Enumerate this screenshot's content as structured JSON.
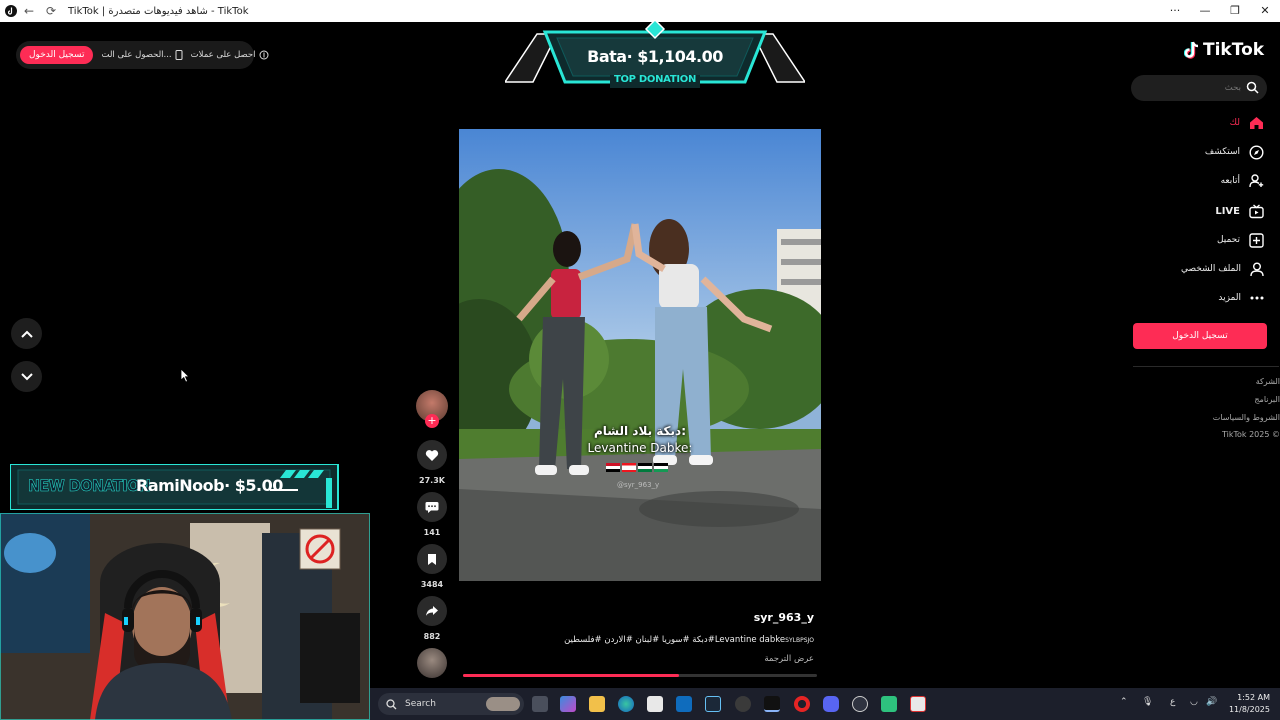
{
  "browser": {
    "tab_title": "TikTok | شاهد فيديوهات متصدرة - TikTok",
    "controls": {
      "minimize": "—",
      "restore": "❐",
      "close": "✕",
      "more": "···"
    }
  },
  "topbar": {
    "signin_label": "تسجيل الدخول",
    "get_app_label": "الحصول على الت...",
    "get_coins_label": "احصل على عملات"
  },
  "overlay_top_donation": {
    "amount_text": "Bata· $1,104.00",
    "caption": "TOP DONATION"
  },
  "overlay_new_donation": {
    "label": "NEW DONATION",
    "donor_text": "RamiNoob· $5.00"
  },
  "video": {
    "caption_line1": "دبكة بلاد الشام:",
    "caption_line2": "Levantine Dabke:",
    "watermark": "@syr_963_y",
    "progress": 0.61
  },
  "actions": {
    "likes": "27.3K",
    "comments": "141",
    "saves": "3484",
    "shares": "882"
  },
  "video_info": {
    "username": "syr_963_y",
    "description": "دبكة #سوريا #لبنان #الاردن #فلسطين#Levantine dabke",
    "description_suffix": "SYLBPSJO",
    "translate_label": "عرض الترجمة"
  },
  "sidebar": {
    "logo_text": "TikTok",
    "search_placeholder": "بحث",
    "items": [
      {
        "label": "لك",
        "icon": "home-icon"
      },
      {
        "label": "استكشف",
        "icon": "compass-icon"
      },
      {
        "label": "أتابعه",
        "icon": "user-plus-icon"
      },
      {
        "label": "LIVE",
        "icon": "live-icon"
      },
      {
        "label": "تحميل",
        "icon": "upload-icon"
      },
      {
        "label": "الملف الشخصي",
        "icon": "profile-icon"
      },
      {
        "label": "المزيد",
        "icon": "more-icon"
      }
    ],
    "signin_button": "تسجيل الدخول",
    "footer": [
      "الشركة",
      "البرنامج",
      "الشروط والسياسات",
      "TikTok 2025 ©"
    ]
  },
  "taskbar": {
    "search_label": "Search",
    "ime": "ع",
    "time": "1:52 AM",
    "date": "11/8/2025"
  },
  "colors": {
    "accent": "#fe2c55",
    "overlay_cyan": "#29e6d6",
    "taskbar": "#1c1f2b"
  }
}
